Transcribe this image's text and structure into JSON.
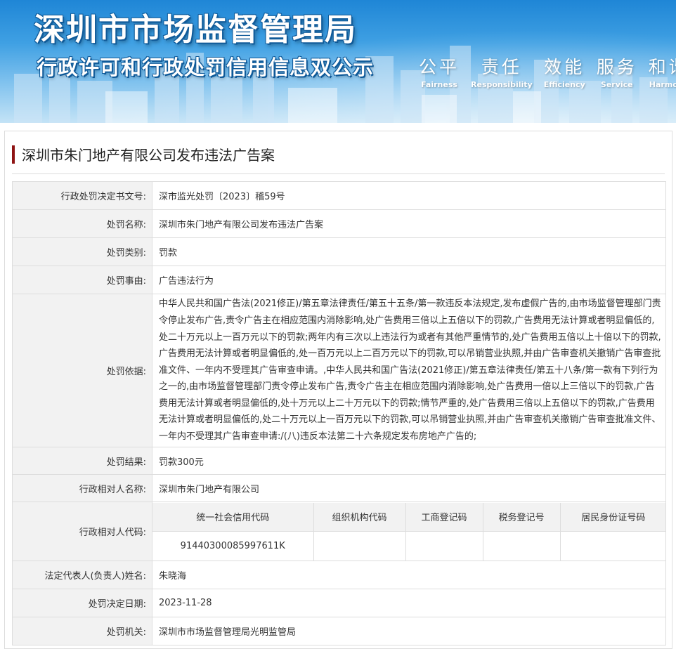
{
  "banner": {
    "title": "深圳市市场监督管理局",
    "subtitle": "行政许可和行政处罚信用信息双公示",
    "mottos": [
      {
        "cn": "公平",
        "en": "Fairness"
      },
      {
        "cn": "责任",
        "en": "Responsibility"
      },
      {
        "cn": "效能",
        "en": "Efficiency"
      },
      {
        "cn": "服务",
        "en": "Service"
      },
      {
        "cn": "和谐",
        "en": "Harmony"
      }
    ]
  },
  "case_title": "深圳市朱门地产有限公司发布违法广告案",
  "rows": {
    "doc_no": {
      "label": "行政处罚决定书文号:",
      "value": "深市监光处罚〔2023〕稽59号"
    },
    "name": {
      "label": "处罚名称:",
      "value": "深圳市朱门地产有限公司发布违法广告案"
    },
    "category": {
      "label": "处罚类别:",
      "value": "罚款"
    },
    "reason": {
      "label": "处罚事由:",
      "value": "广告违法行为"
    },
    "basis": {
      "label": "处罚依据:",
      "value": "中华人民共和国广告法(2021修正)/第五章法律责任/第五十五条/第一款违反本法规定,发布虚假广告的,由市场监督管理部门责令停止发布广告,责令广告主在相应范围内消除影响,处广告费用三倍以上五倍以下的罚款,广告费用无法计算或者明显偏低的,处二十万元以上一百万元以下的罚款;两年内有三次以上违法行为或者有其他严重情节的,处广告费用五倍以上十倍以下的罚款,广告费用无法计算或者明显偏低的,处一百万元以上二百万元以下的罚款,可以吊销营业执照,并由广告审查机关撤销广告审查批准文件、一年内不受理其广告审查申请。,中华人民共和国广告法(2021修正)/第五章法律责任/第五十八条/第一款有下列行为之一的,由市场监督管理部门责令停止发布广告,责令广告主在相应范围内消除影响,处广告费用一倍以上三倍以下的罚款,广告费用无法计算或者明显偏低的,处十万元以上二十万元以下的罚款;情节严重的,处广告费用三倍以上五倍以下的罚款,广告费用无法计算或者明显偏低的,处二十万元以上一百万元以下的罚款,可以吊销营业执照,并由广告审查机关撤销广告审查批准文件、一年内不受理其广告审查申请:/(八)违反本法第二十六条规定发布房地产广告的;"
    },
    "result": {
      "label": "处罚结果:",
      "value": "罚款300元"
    },
    "party": {
      "label": "行政相对人名称:",
      "value": "深圳市朱门地产有限公司"
    },
    "codes": {
      "label": "行政相对人代码:",
      "headers": [
        "统一社会信用代码",
        "组织机构代码",
        "工商登记码",
        "税务登记号",
        "居民身份证号码"
      ],
      "values": [
        "91440300085997611K",
        "",
        "",
        "",
        ""
      ]
    },
    "legal_rep": {
      "label": "法定代表人(负责人)姓名:",
      "value": "朱晓海"
    },
    "date": {
      "label": "处罚决定日期:",
      "value": "2023-11-28"
    },
    "authority": {
      "label": "处罚机关:",
      "value": "深圳市市场监督管理局光明监管局"
    }
  }
}
